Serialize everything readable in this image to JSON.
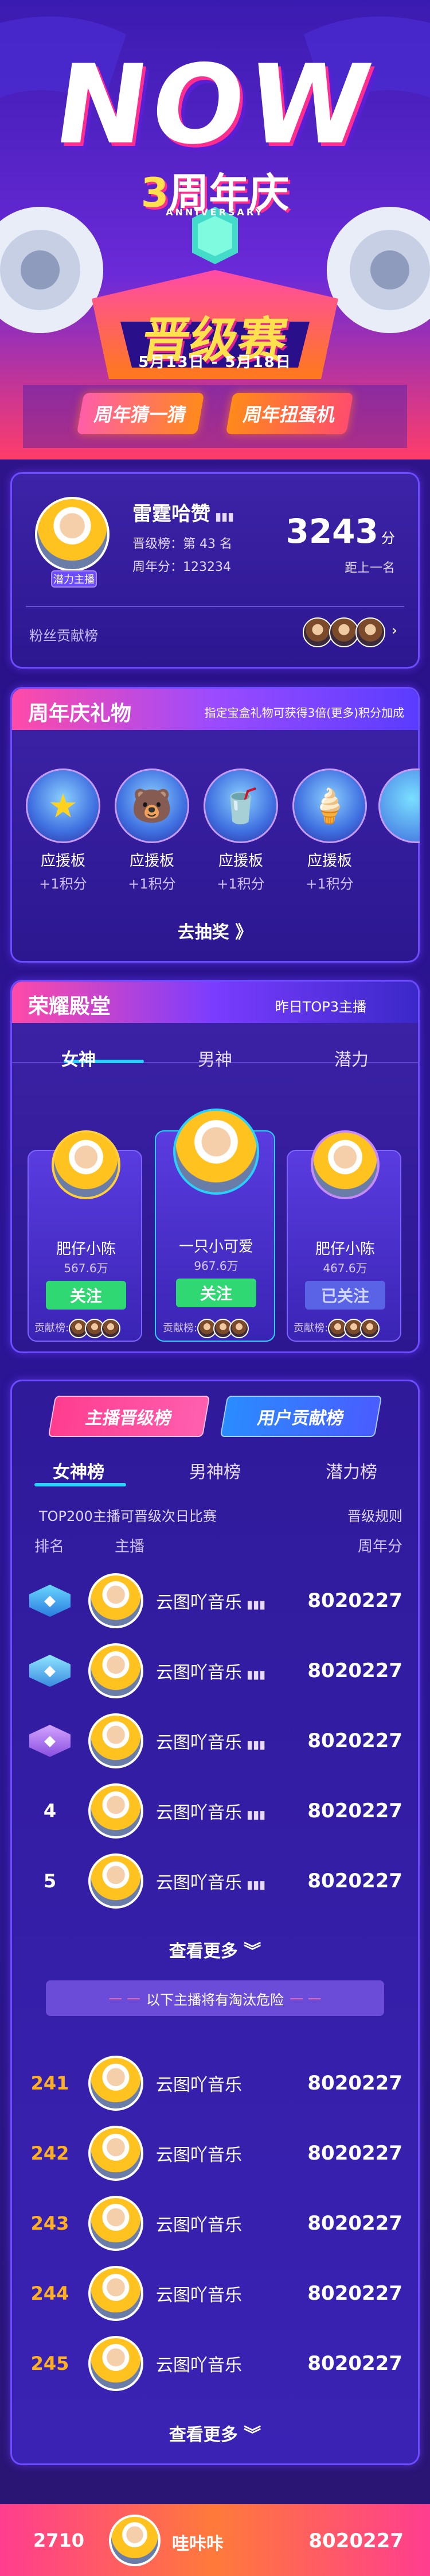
{
  "hero": {
    "logo": "NOW",
    "anniv_number": "3",
    "anniv_title": "周年庆",
    "anniv_sub": "ANNIVERSARY",
    "event_title": "晋级赛",
    "date_range": "5月13日 - 5月18日",
    "btn_guess": "周年猜一猜",
    "btn_egg": "周年扭蛋机"
  },
  "profile": {
    "name": "雷霆哈赞",
    "tag": "潜力主播",
    "level_rank": "晋级榜：第 43 名",
    "anniv_score": "周年分：123234",
    "score": "3243",
    "score_unit": "分",
    "gap_label": "距上一名",
    "fans_label": "粉丝贡献榜"
  },
  "gifts": {
    "title": "周年庆礼物",
    "note": "指定宝盒礼物可获得3倍(更多)积分加成",
    "items": [
      {
        "icon": "star-gift-icon",
        "glyph": "★",
        "name": "应援板",
        "pts": "+1积分"
      },
      {
        "icon": "bear-gift-icon",
        "glyph": "🐻",
        "name": "应援板",
        "pts": "+1积分"
      },
      {
        "icon": "drink-gift-icon",
        "glyph": "🥤",
        "name": "应援板",
        "pts": "+1积分"
      },
      {
        "icon": "icecream-gift-icon",
        "glyph": "🍦",
        "name": "应援板",
        "pts": "+1积分"
      }
    ],
    "cta": "去抽奖 》"
  },
  "hall": {
    "title": "荣耀殿堂",
    "subtitle": "昨日TOP3主播",
    "tabs": [
      "女神",
      "男神",
      "潜力"
    ],
    "winners": [
      {
        "name": "肥仔小陈",
        "value": "567.6万",
        "btn": "关注",
        "contrib": "贡献榜:"
      },
      {
        "name": "一只小可爱",
        "value": "967.6万",
        "btn": "关注",
        "contrib": "贡献榜:"
      },
      {
        "name": "肥仔小陈",
        "value": "467.6万",
        "btn": "已关注",
        "contrib": "贡献榜:"
      }
    ]
  },
  "ranking": {
    "switch_host": "主播晋级榜",
    "switch_user": "用户贡献榜",
    "tabs": [
      "女神榜",
      "男神榜",
      "潜力榜"
    ],
    "info": "TOP200主播可晋级次日比赛",
    "rules": "晋级规则",
    "col_rank": "排名",
    "col_host": "主播",
    "col_score": "周年分",
    "top": [
      {
        "rank": "1",
        "name": "云图吖音乐",
        "score": "8020227"
      },
      {
        "rank": "2",
        "name": "云图吖音乐",
        "score": "8020227"
      },
      {
        "rank": "3",
        "name": "云图吖音乐",
        "score": "8020227"
      },
      {
        "rank": "4",
        "name": "云图吖音乐",
        "score": "8020227"
      },
      {
        "rank": "5",
        "name": "云图吖音乐",
        "score": "8020227"
      }
    ],
    "more": "查看更多",
    "danger": "以下主播将有淘汰危险",
    "danger_rows": [
      {
        "rank": "241",
        "name": "云图吖音乐",
        "score": "8020227"
      },
      {
        "rank": "242",
        "name": "云图吖音乐",
        "score": "8020227"
      },
      {
        "rank": "243",
        "name": "云图吖音乐",
        "score": "8020227"
      },
      {
        "rank": "244",
        "name": "云图吖音乐",
        "score": "8020227"
      },
      {
        "rank": "245",
        "name": "云图吖音乐",
        "score": "8020227"
      }
    ],
    "more2": "查看更多"
  },
  "footer": {
    "rank": "2710",
    "name": "哇咔咔",
    "score": "8020227"
  },
  "colors": {
    "accent_pink": "#ff3d8f",
    "accent_cyan": "#27d2ff",
    "gold": "#ffb020",
    "follow_green": "#30d873"
  }
}
